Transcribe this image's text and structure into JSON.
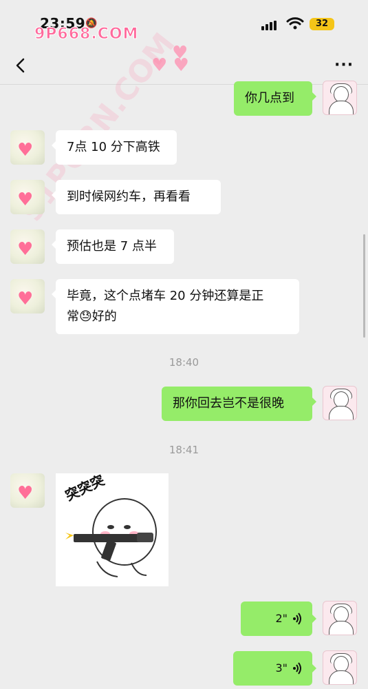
{
  "status_bar": {
    "time": "23:59",
    "battery": "32",
    "watermark": "9P668.COM"
  },
  "overlay_watermark": "91PORN.COM",
  "messages": [
    {
      "side": "right",
      "text": "你几点到"
    },
    {
      "side": "left",
      "text": "7点 10 分下高铁"
    },
    {
      "side": "left",
      "text": "到时候网约车，再看看"
    },
    {
      "side": "left",
      "text": "预估也是 7 点半"
    },
    {
      "side": "left",
      "text_line1": "毕竟，这个点堵车 20 分钟还算是正",
      "text_line2": "常😓好的"
    },
    {
      "side": "right",
      "text": "那你回去岂不是很晚"
    }
  ],
  "timestamps": [
    "18:40",
    "18:41"
  ],
  "sticker": {
    "caption": "突突突"
  },
  "voice_messages": [
    {
      "duration": "2\""
    },
    {
      "duration": "3\""
    }
  ],
  "colors": {
    "background": "#ededed",
    "bubble_me": "#95ec69",
    "bubble_friend": "#ffffff",
    "watermark": "#ff6a9c"
  },
  "icons": {
    "back": "chevron-left-icon",
    "more": "more-dots-icon",
    "voice": "voice-wave-icon",
    "wifi": "wifi-icon",
    "signal": "signal-icon",
    "battery": "battery-icon",
    "bell": "silent-bell-icon"
  }
}
